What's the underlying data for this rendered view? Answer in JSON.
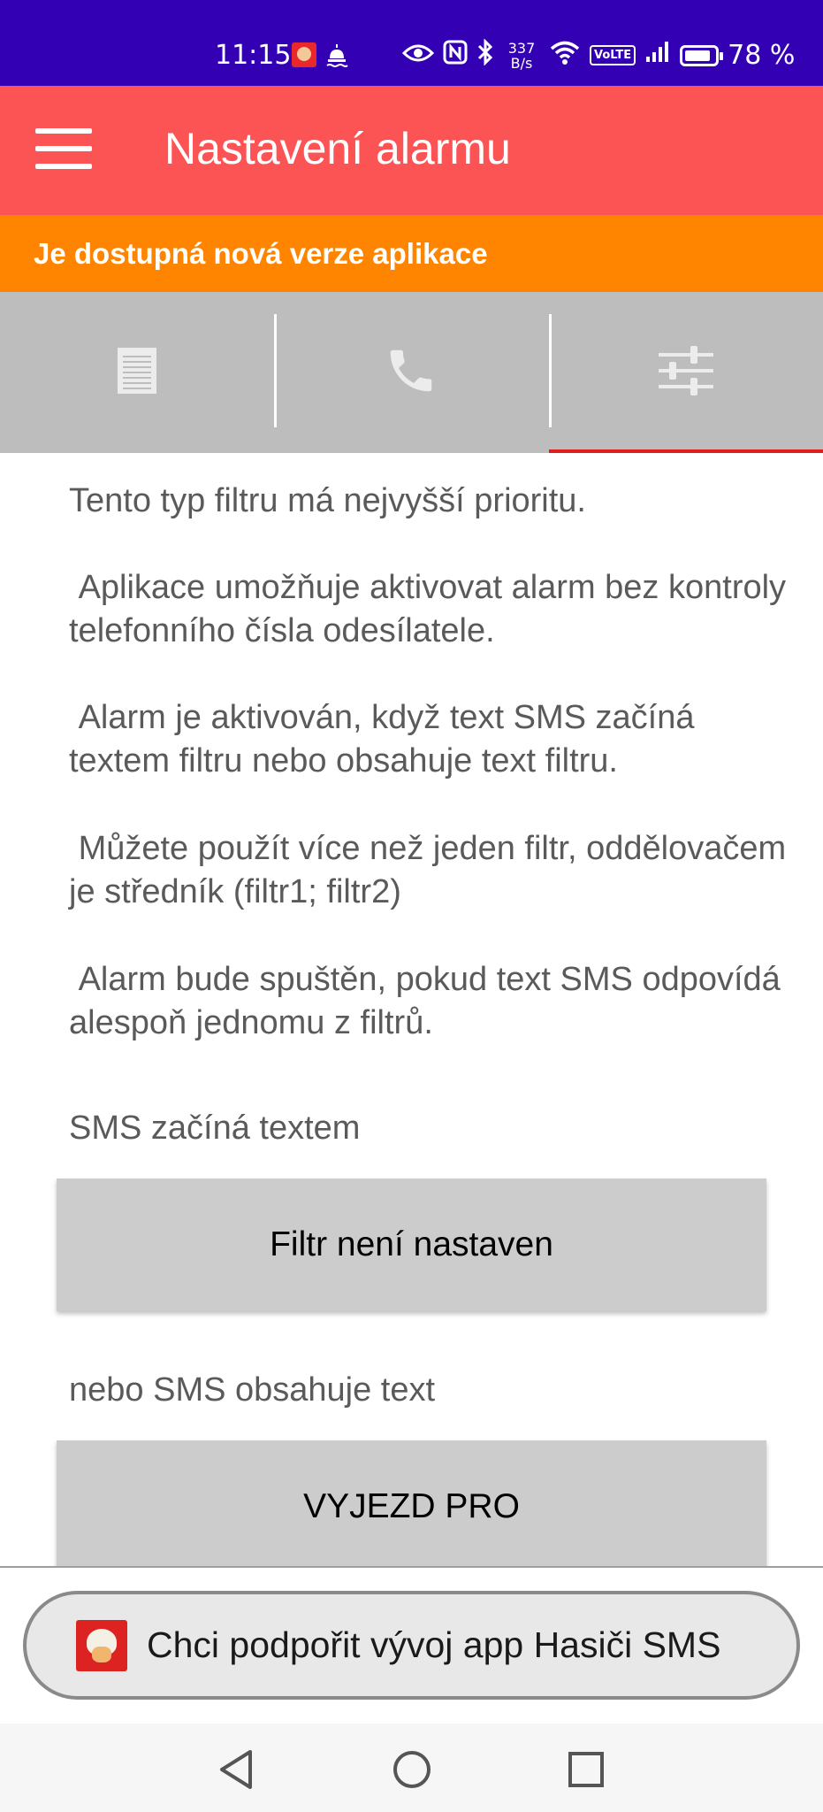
{
  "status_bar": {
    "time": "11:15",
    "net_speed_value": "337",
    "net_speed_unit": "B/s",
    "volte": "VoLTE",
    "battery": "78 %",
    "icons": [
      "app-notification-icon",
      "alarm-icon",
      "eye-icon",
      "nfc-icon",
      "bluetooth-icon",
      "wifi-icon",
      "volte-icon",
      "signal-icon",
      "battery-icon"
    ]
  },
  "app_bar": {
    "title": "Nastavení alarmu",
    "menu_icon": "hamburger-menu-icon"
  },
  "banner": {
    "text": "Je dostupná nová verze aplikace",
    "color": "#ff8500"
  },
  "tabs": [
    {
      "icon": "document-icon",
      "active": false
    },
    {
      "icon": "phone-icon",
      "active": false
    },
    {
      "icon": "sliders-icon",
      "active": true
    }
  ],
  "content": {
    "paragraphs": [
      "Tento typ filtru má nejvyšší prioritu.",
      " Aplikace umožňuje aktivovat alarm bez kontroly telefonního čísla odesílatele.",
      " Alarm je aktivován, když text SMS začíná textem filtru nebo obsahuje text filtru.",
      " Můžete použít více než jeden filtr, oddělovačem je středník (filtr1; filtr2)",
      " Alarm bude spuštěn, pokud text SMS odpovídá alespoň jednomu z filtrů."
    ],
    "starts_with_label": "SMS začíná textem",
    "starts_with_value": "Filtr není nastaven",
    "contains_label": "nebo SMS obsahuje text",
    "contains_value": "VYJEZD PRO"
  },
  "support_button": {
    "label": "Chci podpořit vývoj app Hasiči SMS"
  },
  "nav_bar": {
    "items": [
      "back-icon",
      "home-icon",
      "recents-icon"
    ]
  },
  "colors": {
    "status_bar": "#3300b3",
    "app_bar": "#fc5355",
    "tab_bar": "#bdbdbd",
    "tab_indicator": "#e01e1e"
  }
}
